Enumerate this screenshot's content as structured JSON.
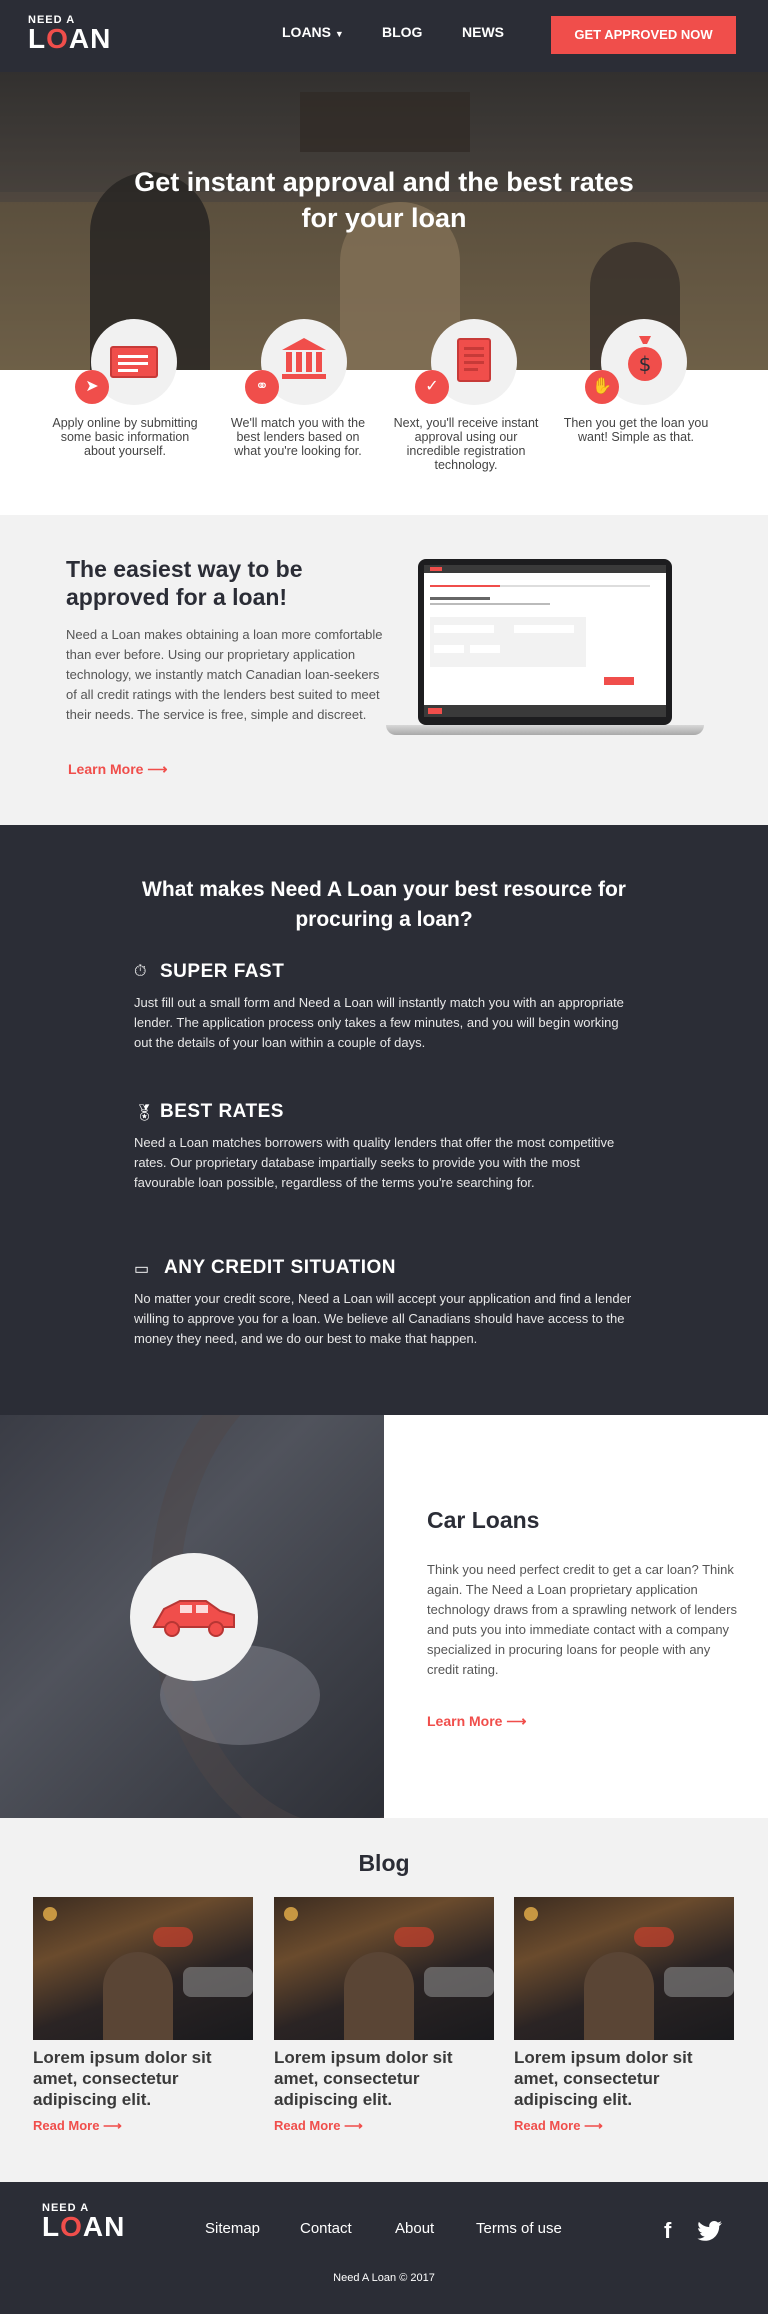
{
  "header": {
    "logo_top": "NEED A",
    "logo_l": "L",
    "logo_o": "O",
    "logo_rest": "AN",
    "nav": [
      {
        "label": "LOANS"
      },
      {
        "label": "BLOG"
      },
      {
        "label": "NEWS"
      }
    ],
    "cta_label": "GET APPROVED NOW"
  },
  "hero": {
    "title": "Get instant approval and the best rates for your loan"
  },
  "steps": [
    {
      "text": "Apply online by submitting some basic information about yourself.",
      "icon": "form-icon",
      "badge_icon": "send-icon"
    },
    {
      "text": "We'll match you with the best lenders based on what you're looking for.",
      "icon": "bank-icon",
      "badge_icon": "link-icon"
    },
    {
      "text": "Next, you'll receive instant approval using our incredible registration technology.",
      "icon": "document-icon",
      "badge_icon": "check-icon"
    },
    {
      "text": "Then you get the loan you want! Simple as that.",
      "icon": "money-bag-icon",
      "badge_icon": "hand-icon"
    }
  ],
  "easiest": {
    "title": "The easiest way to be approved for a loan!",
    "body": "Need a Loan makes obtaining a loan more comfortable than ever before. Using our proprietary application technology, we instantly match Canadian loan-seekers of all credit ratings with the lenders best suited to meet their needs. The service is free, simple and discreet.",
    "more": "Learn More"
  },
  "features": {
    "title": "What makes Need A Loan your best resource for procuring a loan?",
    "items": [
      {
        "title": "SUPER FAST",
        "icon": "stopwatch-icon",
        "text": "Just fill out a small form and Need a Loan will instantly match you with an appropriate lender. The application process only takes a few minutes, and you will begin working out the details of your loan within a couple of days."
      },
      {
        "title": "BEST RATES",
        "icon": "award-icon",
        "text": "Need a Loan matches borrowers with quality lenders that offer the most competitive rates. Our proprietary database impartially seeks to provide you with the most favourable loan possible, regardless of the terms you're searching for."
      },
      {
        "title": "ANY CREDIT SITUATION",
        "icon": "credit-card-icon",
        "text": "No matter your credit score, Need a Loan will accept your application and find a lender willing to approve you for a loan. We believe all Canadians should have access to the money they need, and we do our best to make that happen."
      }
    ]
  },
  "car": {
    "title": "Car Loans",
    "body": "Think you need perfect credit to get a car loan? Think again. The Need a Loan proprietary application technology draws from a sprawling network of lenders and puts you into immediate contact with a company specialized in procuring loans for people with any credit rating.",
    "more": "Learn More"
  },
  "blog": {
    "title": "Blog",
    "posts": [
      {
        "title": "Lorem ipsum dolor sit amet, consectetur adipiscing elit.",
        "more": "Read More"
      },
      {
        "title": "Lorem ipsum dolor sit amet, consectetur adipiscing elit.",
        "more": "Read More"
      },
      {
        "title": "Lorem ipsum dolor sit amet, consectetur adipiscing elit.",
        "more": "Read More"
      }
    ]
  },
  "footer": {
    "logo_top": "NEED A",
    "logo_l": "L",
    "logo_o": "O",
    "logo_rest": "AN",
    "links": [
      {
        "label": "Sitemap"
      },
      {
        "label": "Contact"
      },
      {
        "label": "About"
      },
      {
        "label": "Terms of use"
      }
    ],
    "copyright": "Need A Loan © 2017"
  },
  "colors": {
    "accent": "#f04e4b",
    "dark": "#2b2d36",
    "light_bg": "#f2f2f2"
  }
}
